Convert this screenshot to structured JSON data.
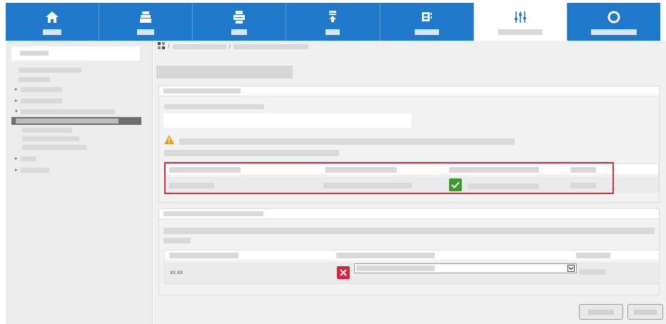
{
  "nav": {
    "tabs": [
      {
        "icon": "home-icon",
        "active": false
      },
      {
        "icon": "scanner-icon",
        "active": false
      },
      {
        "icon": "printer-icon",
        "active": false
      },
      {
        "icon": "download-icon",
        "active": false
      },
      {
        "icon": "device-icon",
        "active": false
      },
      {
        "icon": "settings-sliders-icon",
        "active": true
      },
      {
        "icon": "support-icon",
        "active": false
      }
    ]
  },
  "table_b": {
    "cell_value": "xx.xx"
  },
  "colors": {
    "nav_bg": "#1f78c9",
    "highlight_border": "#d32f3f",
    "ok_green": "#3e9a2e",
    "error_red": "#d8233a",
    "warning_orange": "#f39c12"
  }
}
